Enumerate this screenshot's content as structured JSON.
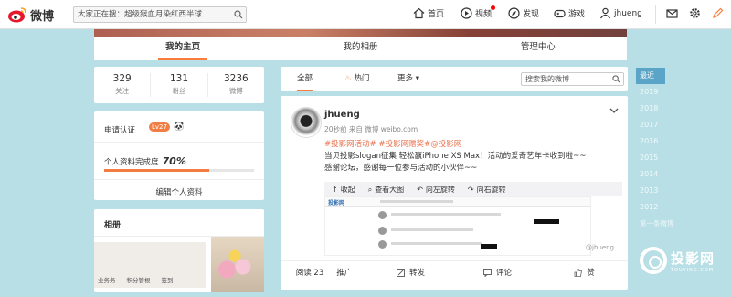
{
  "header": {
    "logo_text": "微博",
    "search_placeholder": "大家正在搜：超级猴血月染红西半球",
    "nav": [
      {
        "label": "首页",
        "icon": "home-icon"
      },
      {
        "label": "视频",
        "icon": "video-icon"
      },
      {
        "label": "发现",
        "icon": "discover-icon"
      },
      {
        "label": "游戏",
        "icon": "game-icon"
      },
      {
        "label": "jhueng",
        "icon": "user-icon"
      }
    ]
  },
  "profile_tabs": [
    "我的主页",
    "我的相册",
    "管理中心"
  ],
  "stats": [
    {
      "num": "329",
      "label": "关注"
    },
    {
      "num": "131",
      "label": "粉丝"
    },
    {
      "num": "3236",
      "label": "微博"
    }
  ],
  "info": {
    "verify": "申请认证",
    "level": "Lv27",
    "completion_label": "个人资料完成度",
    "completion_value": "70%",
    "completion_fraction": 0.7,
    "edit": "编辑个人资料"
  },
  "album": {
    "title": "相册",
    "tabs": [
      "业务务",
      "积分管根",
      "签到"
    ]
  },
  "feed_tabs": {
    "all": "全部",
    "hot": "热门",
    "more": "更多",
    "search_placeholder": "搜索我的微博"
  },
  "post": {
    "username": "jhueng",
    "meta": "20秒前 来自 微博 weibo.com",
    "tags": "#投影网活动# #投影网赠奖#@投影网",
    "text_line1": "当贝投影slogan征集 轻松赢iPhone XS Max！活动的爱奇艺年卡收到啦~~",
    "text_line2": "感谢论坛，感谢每一位参与活动的小伙伴~~",
    "media_actions": [
      "收起",
      "查看大图",
      "向左旋转",
      "向右旋转"
    ],
    "watermark": "@jhueng",
    "actions": {
      "read": "阅读 23",
      "promote": "推广",
      "repost": "转发",
      "comment": "评论",
      "like": "赞"
    }
  },
  "years": [
    "最近",
    "2019",
    "2018",
    "2017",
    "2016",
    "2015",
    "2014",
    "2013",
    "2012",
    "第一条微博"
  ],
  "brand": {
    "big": "投影网",
    "small": "TOUYING.COM"
  },
  "colors": {
    "accent": "#fa7d3c",
    "tag": "#eb7350",
    "page_bg": "#b7dfe5"
  }
}
